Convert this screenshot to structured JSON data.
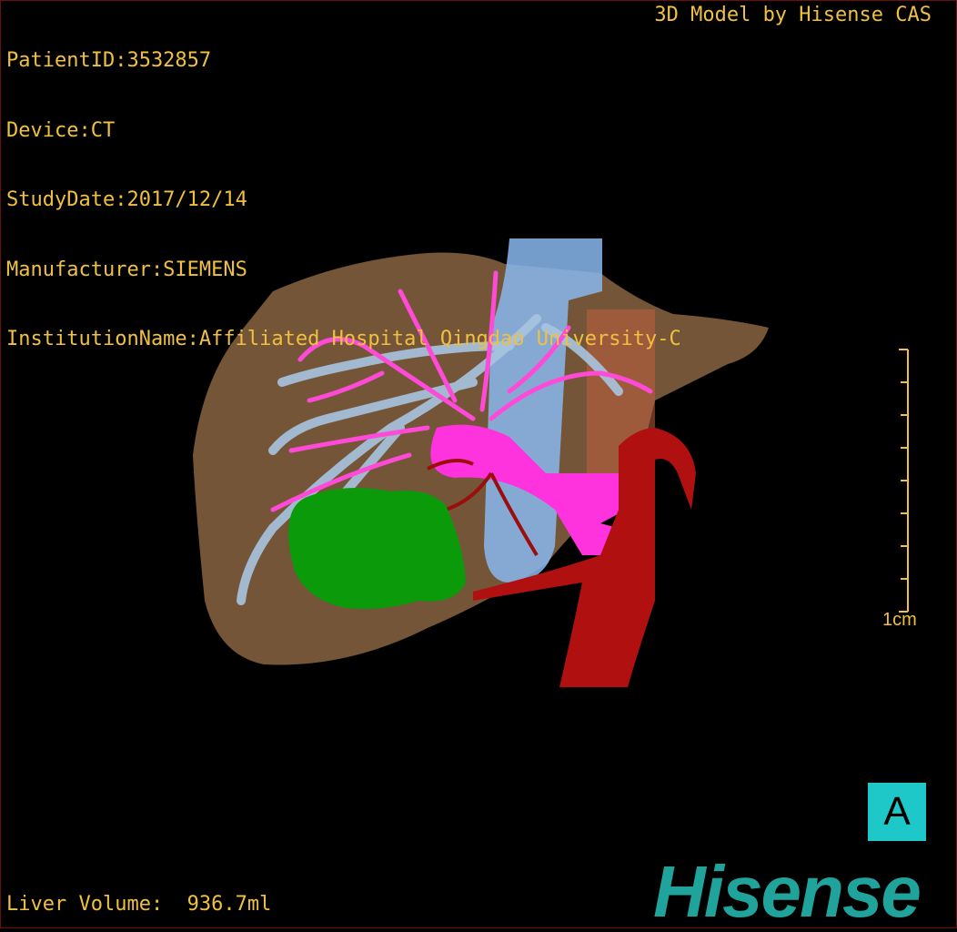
{
  "header": {
    "patient_id": "PatientID:3532857",
    "device": "Device:CT",
    "study_date": "StudyDate:2017/12/14",
    "manufacturer": "Manufacturer:SIEMENS",
    "institution": "InstitutionName:Affiliated Hospital Qingdao University-C"
  },
  "brand_caption": "3D Model by Hisense CAS",
  "footer": {
    "liver_volume": "Liver Volume:  936.7ml"
  },
  "scale_bar": {
    "label": "1cm"
  },
  "orientation": {
    "label": "A"
  },
  "logo_text": "Hisense",
  "colors": {
    "text": "#f0c040",
    "liver": "#7a5a3a",
    "portal_vein": "#ff4ad8",
    "hepatic_vein": "#a8c4e0",
    "ivc": "#8ab8f0",
    "artery": "#b01010",
    "tumor": "#0a9a0a",
    "orientation_box": "#1ec8c8",
    "logo": "#1fa39a"
  },
  "icons": {
    "orientation": "anterior-view-icon",
    "logo": "hisense-logo"
  }
}
